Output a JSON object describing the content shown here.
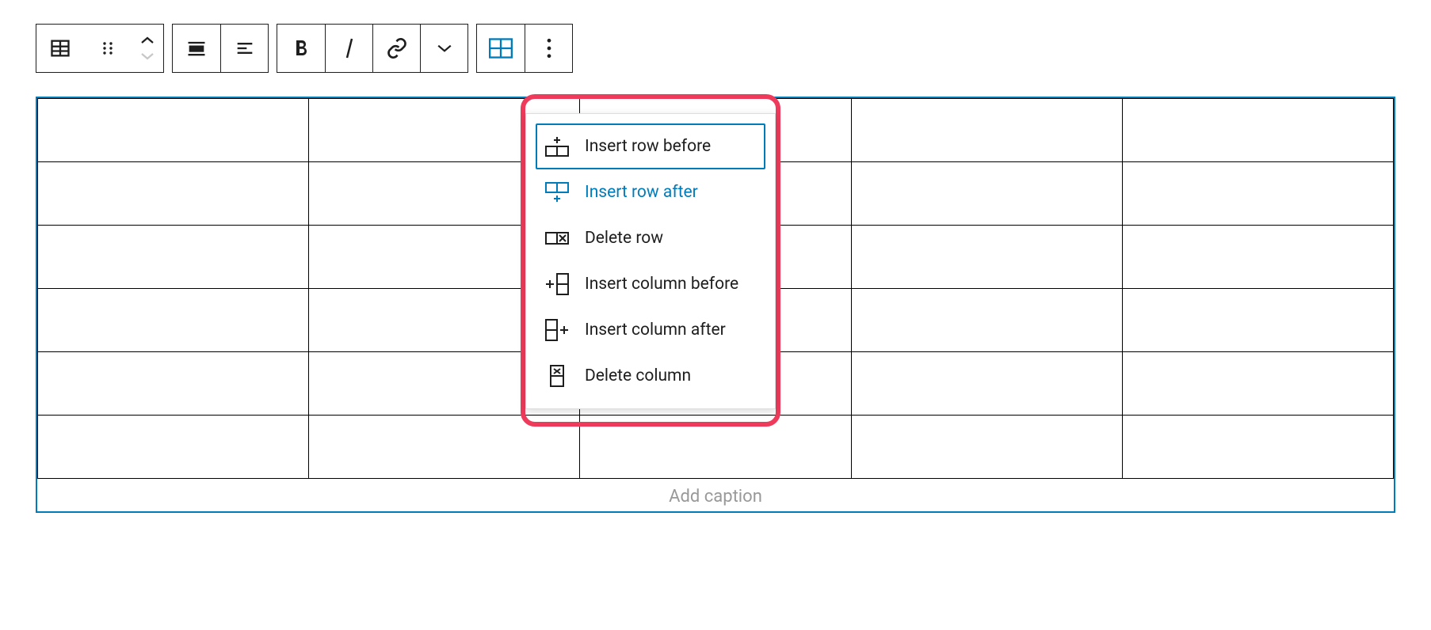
{
  "dropdown": {
    "insert_row_before": "Insert row before",
    "insert_row_after": "Insert row after",
    "delete_row": "Delete row",
    "insert_column_before": "Insert column before",
    "insert_column_after": "Insert column after",
    "delete_column": "Delete column"
  },
  "table": {
    "caption_placeholder": "Add caption",
    "rows": 6,
    "cols": 5
  },
  "colors": {
    "accent": "#007cba",
    "highlight_border": "#ee3b5b"
  }
}
